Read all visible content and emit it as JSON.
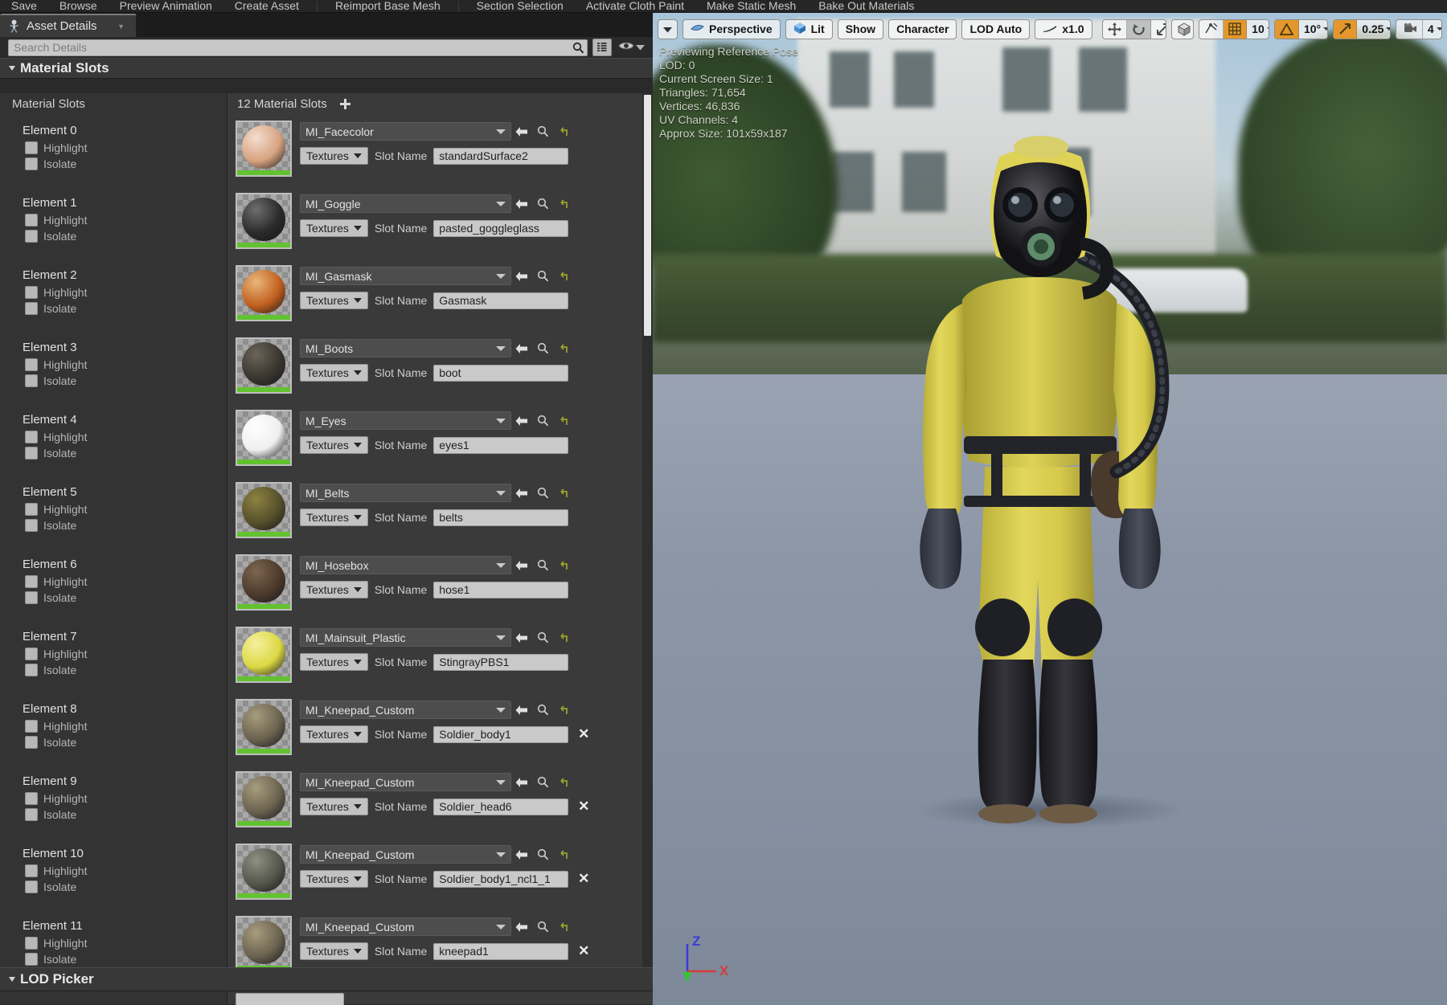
{
  "toolbar": {
    "items": [
      "Save",
      "Browse",
      "Preview Animation",
      "Create Asset",
      "Reimport Base Mesh",
      "Section Selection",
      "Activate Cloth Paint",
      "Make Static Mesh",
      "Bake Out Materials"
    ]
  },
  "tab": {
    "label": "Asset Details",
    "icon": "skeleton-icon"
  },
  "search": {
    "value": "",
    "placeholder": "Search Details"
  },
  "view_buttons": {
    "grid_view": "grid-view-icon",
    "visibility": "eye-icon",
    "visibility_caret": "chevron-down-icon"
  },
  "section": {
    "title": "Material Slots"
  },
  "columns": {
    "left_header": "Material Slots",
    "right_header": "12 Material Slots",
    "add_button": "add-slot-button"
  },
  "checkbox_labels": {
    "highlight": "Highlight",
    "isolate": "Isolate"
  },
  "slot_name_label": "Slot Name",
  "textures_label": "Textures",
  "elements": [
    {
      "label": "Element 0",
      "material": "MI_Facecolor",
      "slot_name": "standardSurface2",
      "thumb": "#d8a380",
      "thumb2": "#f3ded0",
      "deletable": false
    },
    {
      "label": "Element 1",
      "material": "MI_Goggle",
      "slot_name": "pasted_goggleglass",
      "thumb": "#2a2a2a",
      "thumb2": "#6e6e6e",
      "deletable": false
    },
    {
      "label": "Element 2",
      "material": "MI_Gasmask",
      "slot_name": "Gasmask",
      "thumb": "#c2601f",
      "thumb2": "#e9b77a",
      "deletable": false
    },
    {
      "label": "Element 3",
      "material": "MI_Boots",
      "slot_name": "boot",
      "thumb": "#3a3630",
      "thumb2": "#6b6459",
      "deletable": false
    },
    {
      "label": "Element 4",
      "material": "M_Eyes",
      "slot_name": "eyes1",
      "thumb": "#efefef",
      "thumb2": "#ffffff",
      "deletable": false
    },
    {
      "label": "Element 5",
      "material": "MI_Belts",
      "slot_name": "belts",
      "thumb": "#56502c",
      "thumb2": "#8d8240",
      "deletable": false
    },
    {
      "label": "Element 6",
      "material": "MI_Hosebox",
      "slot_name": "hose1",
      "thumb": "#4d3a2c",
      "thumb2": "#7d6550",
      "deletable": false
    },
    {
      "label": "Element 7",
      "material": "MI_Mainsuit_Plastic",
      "slot_name": "StingrayPBS1",
      "thumb": "#dcd843",
      "thumb2": "#f5f0a0",
      "deletable": false
    },
    {
      "label": "Element 8",
      "material": "MI_Kneepad_Custom",
      "slot_name": "Soldier_body1",
      "thumb": "#6b6350",
      "thumb2": "#a79c7e",
      "deletable": true
    },
    {
      "label": "Element 9",
      "material": "MI_Kneepad_Custom",
      "slot_name": "Soldier_head6",
      "thumb": "#6b6350",
      "thumb2": "#a79c7e",
      "deletable": true
    },
    {
      "label": "Element 10",
      "material": "MI_Kneepad_Custom",
      "slot_name": "Soldier_body1_ncl1_1",
      "thumb": "#55564c",
      "thumb2": "#8e9081",
      "deletable": true
    },
    {
      "label": "Element 11",
      "material": "MI_Kneepad_Custom",
      "slot_name": "kneepad1",
      "thumb": "#6b6350",
      "thumb2": "#a79c7e",
      "deletable": true
    }
  ],
  "lod_picker": {
    "title": "LOD Picker"
  },
  "viewport": {
    "toolbar": {
      "menu_caret": "chevron-down-icon",
      "perspective": "Perspective",
      "lit": "Lit",
      "show": "Show",
      "character": "Character",
      "lod": "LOD Auto",
      "playrate": "x1.0",
      "transform_move": "move-gizmo-icon",
      "transform_rotate": "rotate-gizmo-icon",
      "transform_scale": "scale-gizmo-icon",
      "coord_space": "world-space-icon",
      "surface_snap": "surface-snap-icon",
      "grid_snap_icon": "grid-snap-icon",
      "grid_snap_value": "10",
      "angle_snap_icon": "angle-snap-icon",
      "angle_snap_value": "10°",
      "scale_snap_icon": "scale-snap-icon",
      "scale_snap_value": "0.25",
      "camera_speed_icon": "camera-speed-icon",
      "camera_speed_value": "4"
    },
    "stats": [
      "Previewing Reference Pose",
      "LOD: 0",
      "Current Screen Size: 1",
      "Triangles: 71,654",
      "Vertices: 46,836",
      "UV Channels: 4",
      "Approx Size: 101x59x187"
    ],
    "axis": {
      "z": "Z",
      "x": "X"
    }
  },
  "colors": {
    "accent_orange": "#e3972c",
    "panel_bg": "#2a2a2a",
    "section_bg": "#383838",
    "thumb_floor_green": "#62c230",
    "suit_yellow": "#d9cf4e"
  }
}
